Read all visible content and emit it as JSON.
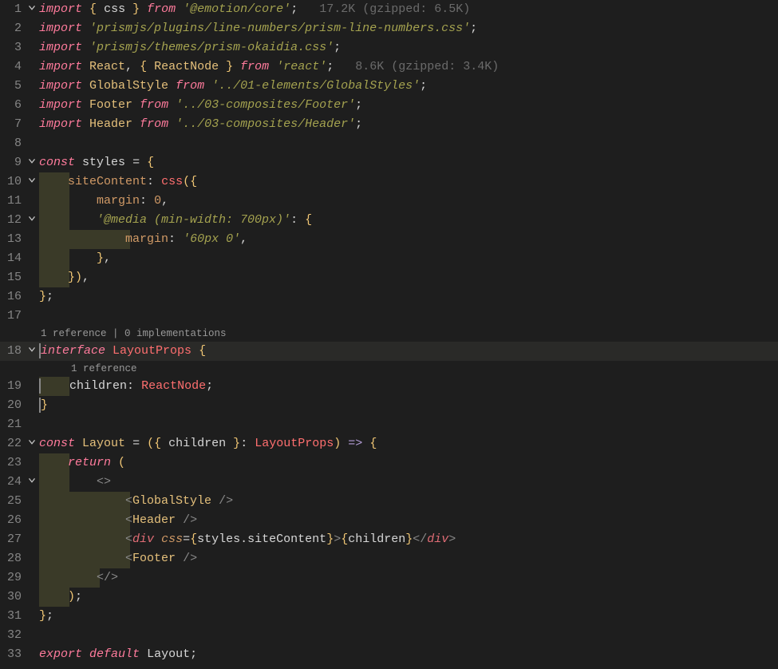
{
  "gutter": {
    "1": "1",
    "2": "2",
    "3": "3",
    "4": "4",
    "5": "5",
    "6": "6",
    "7": "7",
    "8": "8",
    "9": "9",
    "10": "10",
    "11": "11",
    "12": "12",
    "13": "13",
    "14": "14",
    "15": "15",
    "16": "16",
    "17": "17",
    "18": "18",
    "19": "19",
    "20": "20",
    "21": "21",
    "22": "22",
    "23": "23",
    "24": "24",
    "25": "25",
    "26": "26",
    "27": "27",
    "28": "28",
    "29": "29",
    "30": "30",
    "31": "31",
    "32": "32",
    "33": "33"
  },
  "codelens": {
    "l18": "1 reference | 0 implementations",
    "l19": "1 reference"
  },
  "tok": {
    "import": "import",
    "from": "from",
    "const": "const",
    "interface": "interface",
    "return": "return",
    "export": "export",
    "default": "default",
    "lbrace": "{",
    "rbrace": "}",
    "lparen": "(",
    "rparen": ")",
    "lt": "<",
    "gt": ">",
    "slashgt": "/>",
    "ltslash": "</",
    "fragOpen": "<>",
    "fragClose": "</>",
    "comma": ",",
    "colon": ":",
    "semi": ";",
    "eq": "=",
    "arrow": "=>",
    "dot": "."
  },
  "ident": {
    "css": "css",
    "React": "React",
    "ReactNode": "ReactNode",
    "GlobalStyle": "GlobalStyle",
    "Footer": "Footer",
    "Header": "Header",
    "styles": "styles",
    "siteContent": "siteContent",
    "margin": "margin",
    "LayoutProps": "LayoutProps",
    "children": "children",
    "Layout": "Layout",
    "div": "div"
  },
  "str": {
    "s1": "'@emotion/core'",
    "s2": "'prismjs/plugins/line-numbers/prism-line-numbers.css'",
    "s3": "'prismjs/themes/prism-okaidia.css'",
    "s4": "'react'",
    "s5": "'../01-elements/GlobalStyles'",
    "s6": "'../03-composites/Footer'",
    "s7": "'../03-composites/Header'",
    "media": "'@media (min-width: 700px)'",
    "marginVal": "'60px 0'"
  },
  "num": {
    "zero": "0"
  },
  "hint": {
    "h1": "17.2K (gzipped: 6.5K)",
    "h4": "8.6K (gzipped: 3.4K)"
  },
  "chart_data": null
}
